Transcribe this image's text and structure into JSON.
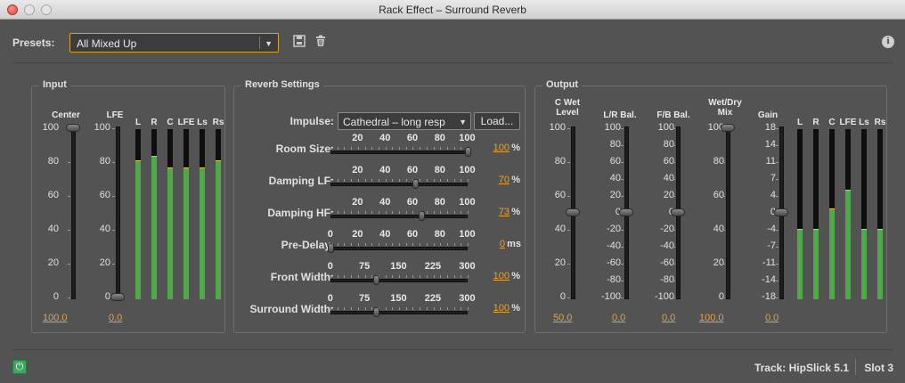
{
  "window": {
    "title": "Rack Effect – Surround Reverb"
  },
  "presets": {
    "label": "Presets:",
    "selected": "All Mixed Up"
  },
  "input": {
    "title": "Input",
    "center_label": "Center",
    "lfe_label": "LFE",
    "scale": [
      "100",
      "80",
      "60",
      "40",
      "20",
      "0"
    ],
    "center_value": "100.0",
    "lfe_value": "0.0",
    "center_level": 1.0,
    "lfe_level": 0.0,
    "meters": [
      {
        "label": "L",
        "level": 0.81
      },
      {
        "label": "R",
        "level": 0.84
      },
      {
        "label": "C",
        "level": 0.77
      },
      {
        "label": "LFE",
        "level": 0.77
      },
      {
        "label": "Ls",
        "level": 0.77
      },
      {
        "label": "Rs",
        "level": 0.81
      }
    ]
  },
  "reverb": {
    "title": "Reverb Settings",
    "impulse_label": "Impulse:",
    "impulse_value": "Cathedral – long resp",
    "load_label": "Load...",
    "sliders": [
      {
        "label": "Room Size:",
        "scale": [
          "20",
          "40",
          "60",
          "80",
          "100"
        ],
        "value": "100",
        "unit": "%",
        "level": 1.0
      },
      {
        "label": "Damping LF:",
        "scale": [
          "20",
          "40",
          "60",
          "80",
          "100"
        ],
        "value": "70",
        "unit": "%",
        "level": 0.62
      },
      {
        "label": "Damping HF:",
        "scale": [
          "20",
          "40",
          "60",
          "80",
          "100"
        ],
        "value": "73",
        "unit": "%",
        "level": 0.66
      },
      {
        "label": "Pre-Delay:",
        "scale": [
          "0",
          "20",
          "40",
          "60",
          "80",
          "100"
        ],
        "value": "0",
        "unit": "ms",
        "level": 0.0
      },
      {
        "label": "Front Width:",
        "scale": [
          "0",
          "75",
          "150",
          "225",
          "300"
        ],
        "value": "100",
        "unit": "%",
        "level": 0.333
      },
      {
        "label": "Surround Width:",
        "scale": [
          "0",
          "75",
          "150",
          "225",
          "300"
        ],
        "value": "100",
        "unit": "%",
        "level": 0.333
      }
    ]
  },
  "output": {
    "title": "Output",
    "cwet_label_1": "C Wet",
    "cwet_label_2": "Level",
    "lr_label": "L/R Bal.",
    "fb_label": "F/B Bal.",
    "wetdry_label_1": "Wet/Dry",
    "wetdry_label_2": "Mix",
    "gain_label": "Gain",
    "scale_100": [
      "100",
      "80",
      "60",
      "40",
      "20",
      "0"
    ],
    "scale_bal": [
      "100",
      "80",
      "60",
      "40",
      "20",
      "0",
      "-20",
      "-40",
      "-60",
      "-80",
      "-100"
    ],
    "scale_gain": [
      "18",
      "14",
      "11",
      "7",
      "4",
      "0",
      "-4",
      "-7",
      "-11",
      "-14",
      "-18"
    ],
    "cwet_value": "50.0",
    "lr_value": "0.0",
    "fb_value": "0.0",
    "wetdry_value": "100.0",
    "gain_value": "0.0",
    "meters": [
      {
        "label": "L",
        "level": 0.41
      },
      {
        "label": "R",
        "level": 0.41
      },
      {
        "label": "C",
        "level": 0.53
      },
      {
        "label": "LFE",
        "level": 0.64
      },
      {
        "label": "Ls",
        "level": 0.41
      },
      {
        "label": "Rs",
        "level": 0.41
      }
    ]
  },
  "footer": {
    "track": "Track: HipSlick 5.1",
    "slot": "Slot 3"
  },
  "colors": {
    "accent": "#e3a33b",
    "meter": "#4fa84a",
    "power": "#3aa860"
  },
  "icons": {
    "save": "save-icon",
    "delete": "trash-icon",
    "info": "info-icon",
    "power": "power-icon"
  }
}
